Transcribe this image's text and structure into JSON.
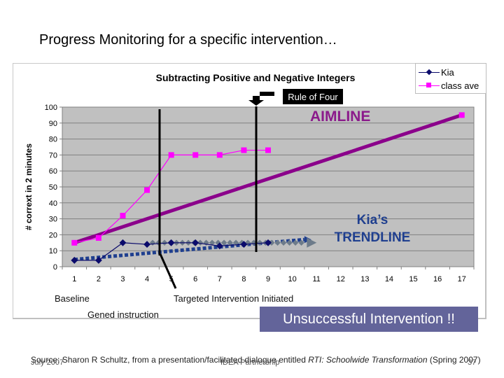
{
  "slide": {
    "title": "Progress Monitoring for a specific intervention…"
  },
  "annotations": {
    "rule_of_four": "Rule of Four",
    "aimline": "AIMLINE",
    "trendline_line1": "Kia’s",
    "trendline_line2": "TRENDLINE",
    "baseline": "Baseline",
    "gened": "Gened instruction",
    "targeted": "Targeted Intervention Initiated",
    "unsuccessful": "Unsuccessful Intervention !!"
  },
  "footer": {
    "source_prefix": "Source: Sharon R Schultz, from a presentation/facilitated dialogue entitled ",
    "source_title": "RTI: Schoolwide Transformation",
    "source_suffix": " (Spring 2007)",
    "date": "July 2007",
    "org": "IDEA Partnership",
    "page": "37"
  },
  "colors": {
    "kia": "#0b0b6b",
    "class_ave": "#ff00ff",
    "aimline": "#8b008b",
    "trendline": "#1f3f8f",
    "plot_bg": "#c0c0c0",
    "callout_bg": "#63649a"
  },
  "chart_data": {
    "type": "line",
    "title": "Subtracting Positive and Negative Integers",
    "xlabel": "",
    "ylabel": "# corrext in 2 minutes",
    "categories": [
      "1",
      "2",
      "3",
      "4",
      "5",
      "6",
      "7",
      "8",
      "9",
      "10",
      "11",
      "12",
      "13",
      "14",
      "15",
      "16",
      "17"
    ],
    "ylim": [
      0,
      100
    ],
    "yticks": [
      0,
      10,
      20,
      30,
      40,
      50,
      60,
      70,
      80,
      90,
      100
    ],
    "grid": true,
    "legend": "top-right",
    "series": [
      {
        "name": "Kia",
        "marker": "diamond",
        "x": [
          1,
          2,
          3,
          4,
          5,
          6,
          7,
          8,
          9
        ],
        "values": [
          4,
          4,
          15,
          14,
          15,
          15,
          13,
          14,
          15
        ]
      },
      {
        "name": "class ave",
        "marker": "square",
        "x": [
          1,
          2,
          3,
          4,
          5,
          6,
          7,
          8,
          9,
          17
        ],
        "values": [
          15,
          18,
          32,
          48,
          70,
          70,
          70,
          73,
          73,
          95
        ]
      }
    ],
    "aimline": {
      "from": [
        1,
        15
      ],
      "to": [
        17,
        95
      ]
    },
    "trendline": {
      "from": [
        1,
        4.5
      ],
      "to": [
        10.5,
        17
      ]
    },
    "phase_lines_x": [
      4.5,
      8.5
    ]
  }
}
